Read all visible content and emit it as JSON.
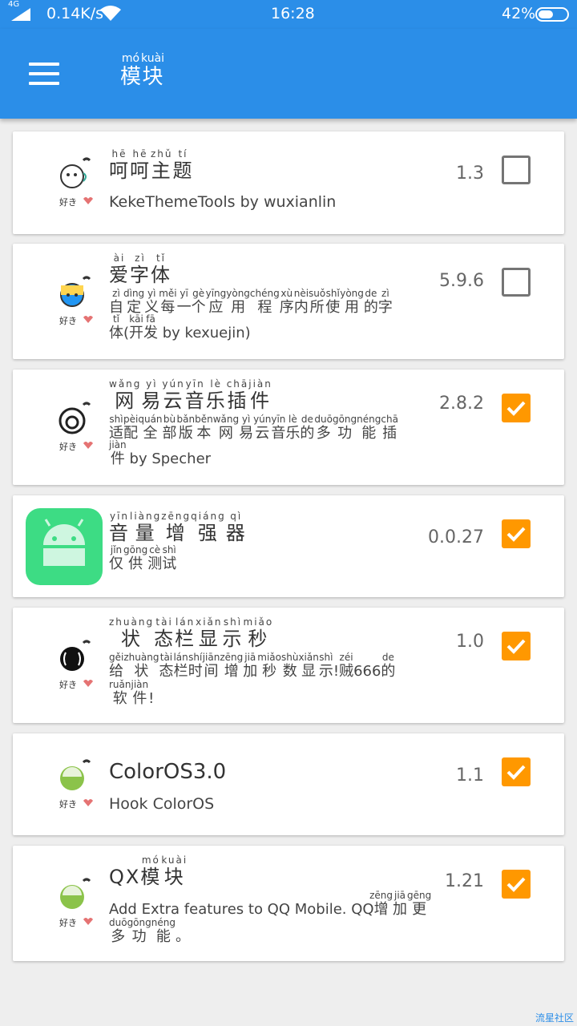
{
  "status_bar": {
    "network": "4G",
    "speed": "0.14K/s",
    "time": "16:28",
    "battery": "42%"
  },
  "app_bar": {
    "menu_icon": "hamburger-menu-icon",
    "title_chars": [
      "模",
      "块"
    ],
    "title_pinyin": [
      "mó",
      "kuài"
    ]
  },
  "modules": [
    {
      "name_chars": [
        "呵",
        "呵",
        "主",
        "题"
      ],
      "name_pinyin": [
        "hē",
        "hē",
        "zhǔ",
        "tí"
      ],
      "description": "KekeThemeTools by wuxianlin",
      "version": "1.3",
      "enabled": false,
      "icon": "keke-theme-icon",
      "icon_caption": "好き"
    },
    {
      "name_chars": [
        "爱",
        "字",
        "体"
      ],
      "name_pinyin": [
        "ài",
        "zì",
        "tǐ"
      ],
      "desc_chars": [
        "自",
        "定",
        "义",
        "每",
        "一",
        "个",
        "应",
        "用",
        "程",
        "序",
        "内",
        "所",
        "使",
        "用",
        "的",
        "字",
        "体",
        "(",
        "开",
        "发"
      ],
      "desc_pinyin": [
        "zì",
        "dìng",
        "yì",
        "měi",
        "yī",
        "gè",
        "yīng",
        "yòng",
        "chéng",
        "xù",
        "nèi",
        "suǒ",
        "shǐ",
        "yòng",
        "de",
        "zì",
        "tǐ",
        "",
        "kāi",
        "fā"
      ],
      "desc_suffix": " by kexuejin)",
      "version": "5.9.6",
      "enabled": false,
      "icon": "font-app-icon",
      "icon_caption": "好き"
    },
    {
      "name_chars": [
        "网",
        "易",
        "云",
        "音",
        "乐",
        "插",
        "件"
      ],
      "name_pinyin": [
        "wǎng",
        "yì",
        "yún",
        "yīn",
        "lè",
        "chā",
        "jiàn"
      ],
      "desc_chars": [
        "适",
        "配",
        "全",
        "部",
        "版",
        "本",
        "网",
        "易",
        "云",
        "音",
        "乐",
        "的",
        "多",
        "功",
        "能",
        "插",
        "件"
      ],
      "desc_pinyin": [
        "shì",
        "pèi",
        "quán",
        "bù",
        "bǎn",
        "běn",
        "wǎng",
        "yì",
        "yún",
        "yīn",
        "lè",
        "de",
        "duō",
        "gōng",
        "néng",
        "chā",
        "jiàn"
      ],
      "desc_suffix": " by Specher",
      "version": "2.8.2",
      "enabled": true,
      "icon": "netease-music-icon",
      "icon_caption": "好き"
    },
    {
      "name_chars": [
        "音",
        "量",
        "增",
        "强",
        "器"
      ],
      "name_pinyin": [
        "yīn",
        "liàng",
        "zēng",
        "qiáng",
        "qì"
      ],
      "desc_chars": [
        "仅",
        "供",
        "测",
        "试"
      ],
      "desc_pinyin": [
        "jǐn",
        "gōng",
        "cè",
        "shì"
      ],
      "version": "0.0.27",
      "enabled": true,
      "icon": "android-robot-icon"
    },
    {
      "name_chars": [
        "状",
        "态",
        "栏",
        "显",
        "示",
        "秒"
      ],
      "name_pinyin": [
        "zhuàng",
        "tài",
        "lán",
        "xiǎn",
        "shì",
        "miǎo"
      ],
      "desc_chars": [
        "给",
        "状",
        "态",
        "栏",
        "时",
        "间",
        "增",
        "加",
        "秒",
        "数",
        "显",
        "示",
        "!",
        "贼",
        "666",
        "的",
        "软",
        "件",
        "!"
      ],
      "desc_pinyin": [
        "gěi",
        "zhuàng",
        "tài",
        "lán",
        "shí",
        "jiān",
        "zēng",
        "jiā",
        "miǎo",
        "shù",
        "xiǎn",
        "shì",
        "",
        "zéi",
        "",
        "de",
        "ruǎn",
        "jiàn",
        ""
      ],
      "version": "1.0",
      "enabled": true,
      "icon": "statusbar-seconds-icon",
      "icon_caption": "好き"
    },
    {
      "name": "ColorOS3.0",
      "description": "Hook ColorOS",
      "version": "1.1",
      "enabled": true,
      "icon": "coloros-android-icon",
      "icon_caption": "好き"
    },
    {
      "name_prefix": "QX",
      "name_chars": [
        "模",
        "块"
      ],
      "name_pinyin": [
        "mó",
        "kuài"
      ],
      "desc_prefix": "Add Extra features to QQ Mobile. QQ",
      "desc_chars": [
        "增",
        "加",
        "更",
        "多",
        "功",
        "能",
        "。"
      ],
      "desc_pinyin": [
        "zēng",
        "jiā",
        "gēng",
        "duō",
        "gōng",
        "néng",
        ""
      ],
      "version": "1.21",
      "enabled": true,
      "icon": "qx-android-icon",
      "icon_caption": "好き"
    }
  ],
  "watermark": "流星社区",
  "colors": {
    "primary": "#2b8ee8",
    "checkbox_on": "#ff9800",
    "checkbox_off": "#757575",
    "background": "#eeeeee"
  }
}
